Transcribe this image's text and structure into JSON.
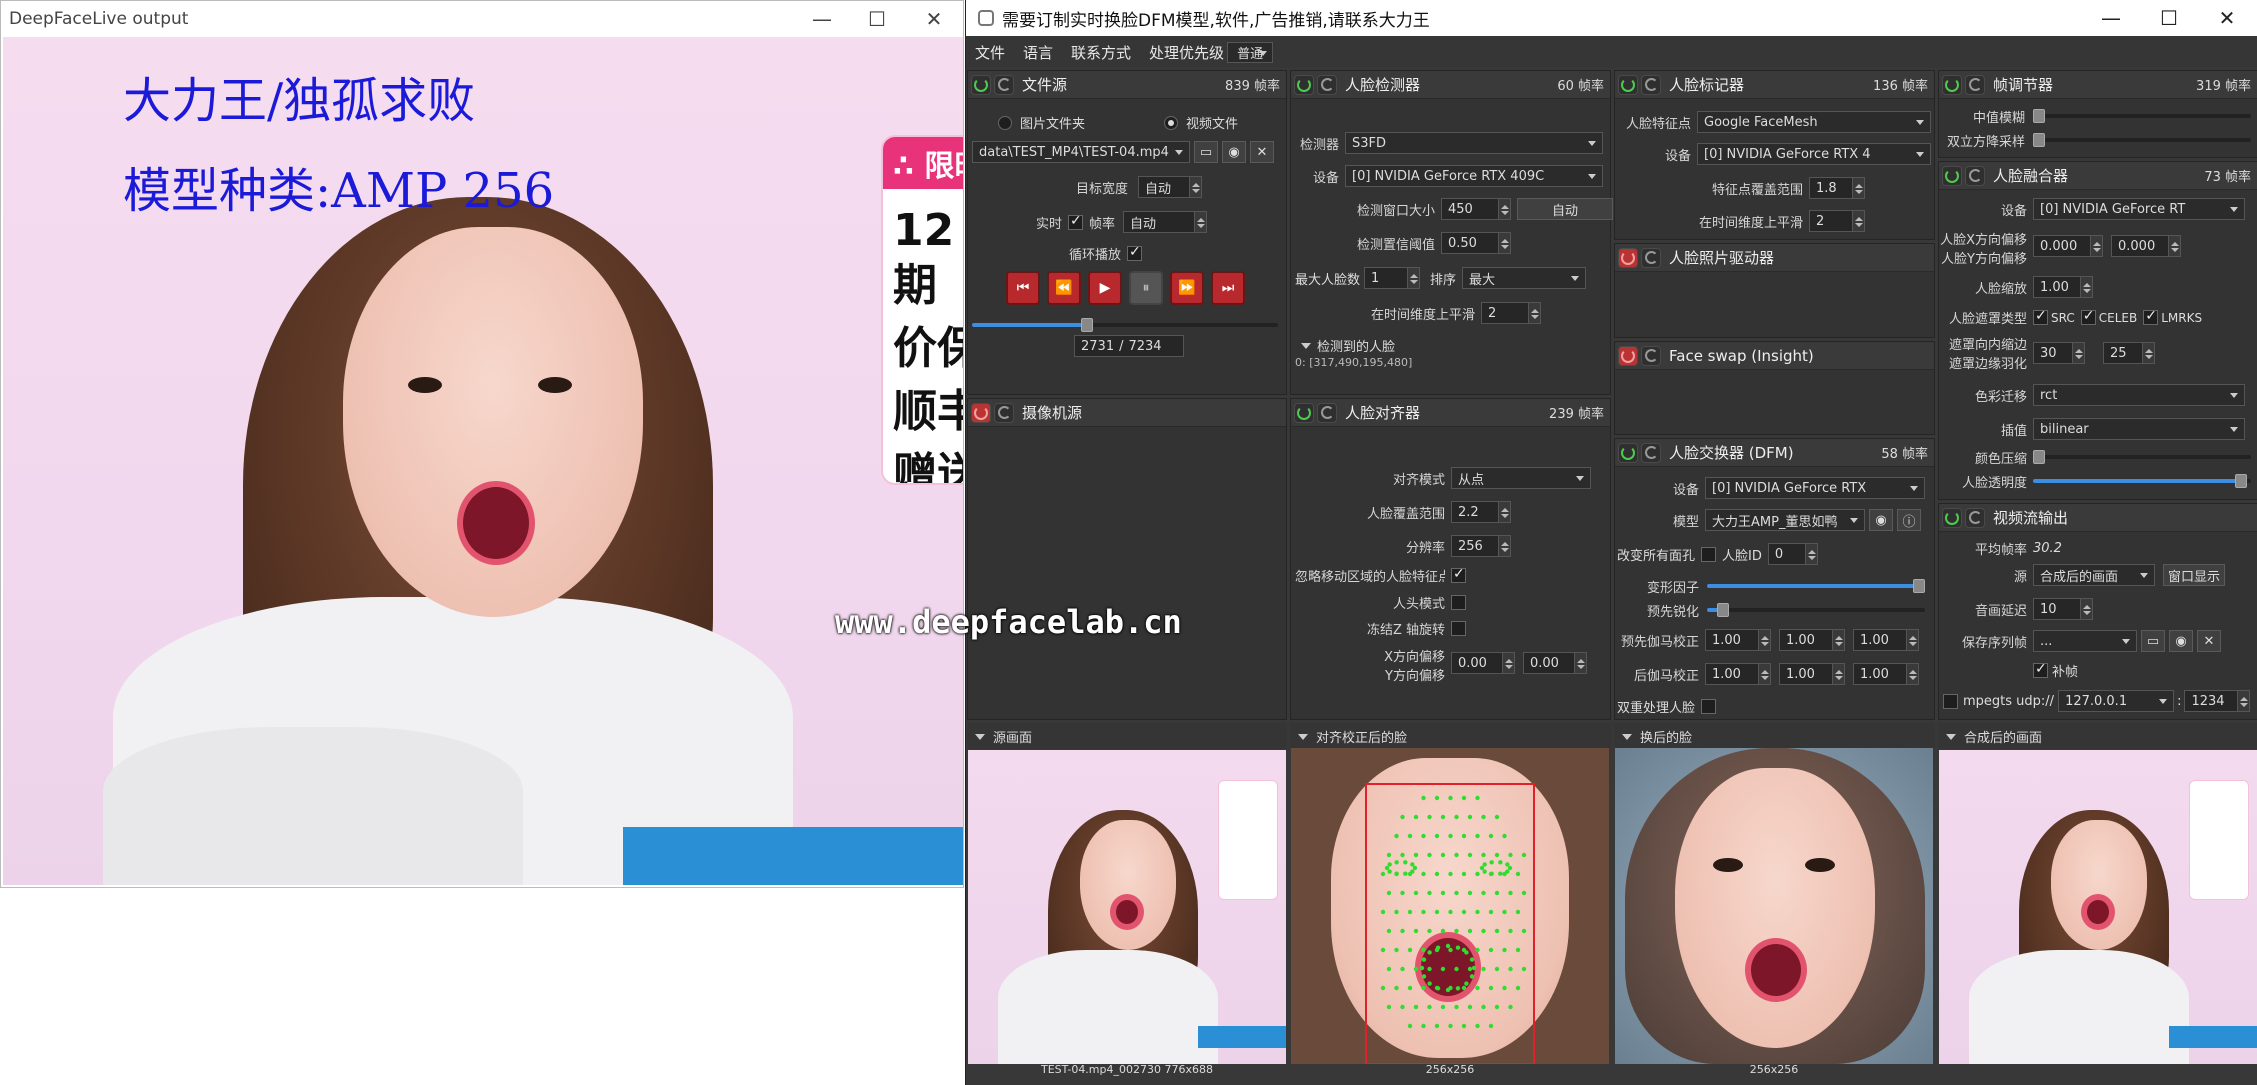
{
  "output_window": {
    "title": "DeepFaceLive output",
    "overlay_name": "大力王/独孤求败",
    "overlay_model": "模型种类:AMP 256",
    "sign_head": "∴ 限时",
    "sign_lines": [
      "12期",
      "价保",
      "顺丰",
      "赠送"
    ],
    "watermark": "www.deepfacelab.cn"
  },
  "app": {
    "title": "需要订制实时换脸DFM模型,软件,广告推销,请联系大力王",
    "menu": [
      "文件",
      "语言",
      "联系方式"
    ],
    "priority_label": "处理优先级",
    "priority_value": "普通"
  },
  "file_source": {
    "title": "文件源",
    "fps": "839 帧率",
    "image_folder": "图片文件夹",
    "video_file": "视频文件",
    "path": "data\\TEST_MP4\\TEST-04.mp4",
    "target_width_label": "目标宽度",
    "target_width_value": "自动",
    "realtime_label": "实时",
    "fps_label": "帧率",
    "fps_value": "自动",
    "loop_label": "循环播放",
    "frame_current": "2731",
    "frame_sep": "/",
    "frame_total": "7234",
    "progress": 0.377
  },
  "camera_source": {
    "title": "摄像机源"
  },
  "face_detector": {
    "title": "人脸检测器",
    "fps": "60 帧率",
    "detector_label": "检测器",
    "detector_value": "S3FD",
    "device_label": "设备",
    "device_value": "[0] NVIDIA GeForce RTX 409C",
    "window_label": "检测窗口大小",
    "window_value": "450",
    "auto_btn": "自动",
    "threshold_label": "检测置信阈值",
    "threshold_value": "0.50",
    "max_faces_label": "最大人脸数",
    "max_faces_value": "1",
    "sort_label": "排序",
    "sort_value": "最大",
    "smooth_label": "在时间维度上平滑",
    "smooth_value": "2",
    "detected_label": "检测到的人脸",
    "detected_value": "0: [317,490,195,480]"
  },
  "face_aligner": {
    "title": "人脸对齐器",
    "fps": "239 帧率",
    "mode_label": "对齐模式",
    "mode_value": "从点",
    "coverage_label": "人脸覆盖范围",
    "coverage_value": "2.2",
    "resolution_label": "分辨率",
    "resolution_value": "256",
    "ignore_label": "忽略移动区域的人脸特征点",
    "head_mode_label": "人头模式",
    "freeze_label": "冻结Z 轴旋转",
    "x_offset_label": "X方向偏移",
    "y_offset_label": "Y方向偏移",
    "x_offset_value": "0.00",
    "y_offset_value": "0.00"
  },
  "face_marker": {
    "title": "人脸标记器",
    "fps": "136 帧率",
    "marker_label": "人脸特征点",
    "marker_value": "Google FaceMesh",
    "device_label": "设备",
    "device_value": "[0] NVIDIA GeForce RTX 4",
    "range_label": "特征点覆盖范围",
    "range_value": "1.8",
    "smooth_label": "在时间维度上平滑",
    "smooth_value": "2"
  },
  "face_animator": {
    "title": "人脸照片驱动器"
  },
  "face_swap_insight": {
    "title": "Face swap (Insight)"
  },
  "face_swapper": {
    "title": "人脸交换器 (DFM)",
    "fps": "58 帧率",
    "device_label": "设备",
    "device_value": "[0] NVIDIA GeForce RTX",
    "model_label": "模型",
    "model_value": "大力王AMP_董思如鸭",
    "swap_all_label": "改变所有面孔",
    "face_id_label": "人脸ID",
    "face_id_value": "0",
    "morph_label": "变形因子",
    "presharpen_label": "预先锐化",
    "pre_gamma_label": "预先伽马校正",
    "post_gamma_label": "后伽马校正",
    "gamma_vals": [
      "1.00",
      "1.00",
      "1.00"
    ],
    "two_pass_label": "双重处理人脸"
  },
  "frame_adjuster": {
    "title": "帧调节器",
    "fps": "319 帧率",
    "median_label": "中值模糊",
    "bilateral_label": "双立方降采样"
  },
  "face_merger": {
    "title": "人脸融合器",
    "fps": "73 帧率",
    "device_label": "设备",
    "device_value": "[0] NVIDIA GeForce RT",
    "x_offset_label": "人脸X方向偏移",
    "y_offset_label": "人脸Y方向偏移",
    "x_offset_value": "0.000",
    "y_offset_value": "0.000",
    "scale_label": "人脸缩放",
    "scale_value": "1.00",
    "mask_label": "人脸遮罩类型",
    "mask_src": "SRC",
    "mask_celeb": "CELEB",
    "mask_lmrks": "LMRKS",
    "erode_label": "遮罩向内缩边",
    "blur_label": "遮罩边缘羽化",
    "erode_value": "30",
    "blur_value": "25",
    "color_label": "色彩迁移",
    "color_value": "rct",
    "interp_label": "插值",
    "interp_value": "bilinear",
    "compress_label": "颜色压缩",
    "opacity_label": "人脸透明度",
    "opacity": 0.98
  },
  "stream_output": {
    "title": "视频流输出",
    "avg_fps_label": "平均帧率",
    "avg_fps_value": "30.2",
    "source_label": "源",
    "source_value": "合成后的画面 ",
    "window_btn": "窗口显示",
    "delay_label": "音画延迟",
    "delay_value": "10",
    "save_label": "保存序列帧",
    "save_value": "...",
    "fill_label": "补帧",
    "mpeg_label": "mpegts udp://",
    "mpeg_host": "127.0.0.1",
    "mpeg_colon": ":",
    "mpeg_port": "1234"
  },
  "views": {
    "source_frame": "源画面",
    "aligned_face": "对齐校正后的脸",
    "swapped_face": "换后的脸",
    "merged_frame": "合成后的画面",
    "source_caption": "TEST-04.mp4_002730 776x688",
    "aligned_caption": "256x256",
    "swapped_caption": "256x256"
  }
}
